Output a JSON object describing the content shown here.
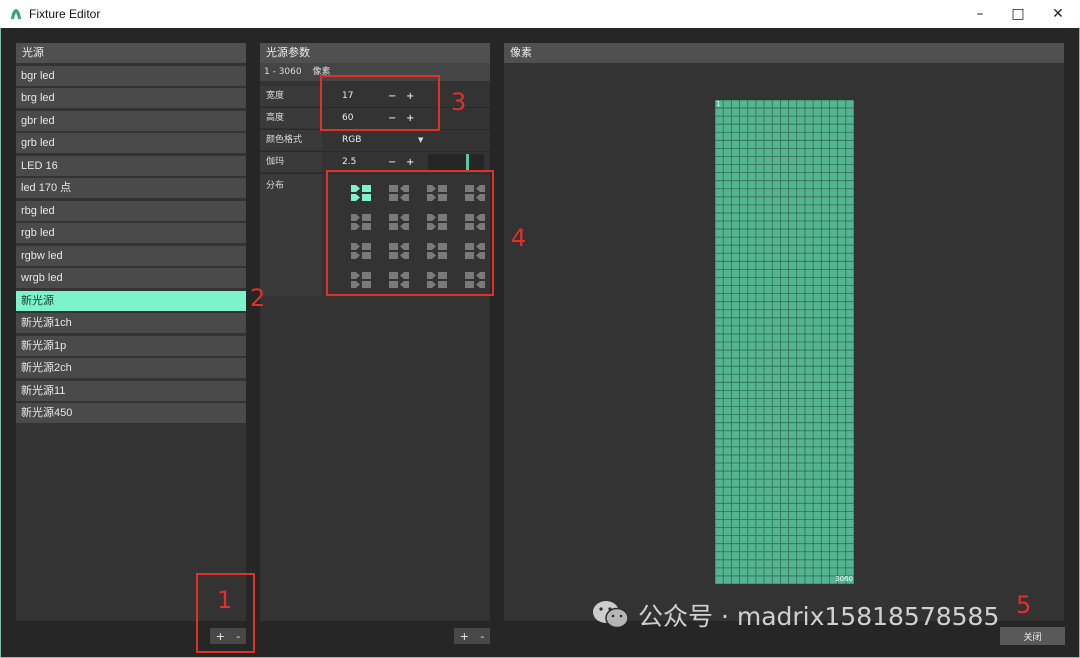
{
  "window": {
    "title": "Fixture Editor"
  },
  "fixtures_panel": {
    "title": "光源",
    "items": [
      "bgr led",
      "brg led",
      "gbr led",
      "grb led",
      "LED 16",
      "led 170 点",
      "rbg led",
      "rgb led",
      "rgbw led",
      "wrgb led",
      "新光源",
      "新光源1ch",
      "新光源1p",
      "新光源2ch",
      "新光源11",
      "新光源450"
    ],
    "selected_index": 10,
    "add_label": "+",
    "remove_label": "-"
  },
  "params_panel": {
    "title": "光源参数",
    "range_label": "1 - 3060",
    "pixel_label": "像素",
    "width": {
      "label": "宽度",
      "value": "17"
    },
    "height": {
      "label": "高度",
      "value": "60"
    },
    "color_format": {
      "label": "颜色格式",
      "value": "RGB"
    },
    "gamma": {
      "label": "伽玛",
      "value": "2.5"
    },
    "distribution": {
      "label": "分布"
    },
    "minus_label": "−",
    "plus_label": "+",
    "add_label": "+",
    "remove_label": "-"
  },
  "pixels_panel": {
    "title": "像素",
    "start_label": "1",
    "end_label": "3060",
    "columns": 17,
    "rows": 60,
    "fill_color": "#55b591",
    "grid_color": "#2f6b57"
  },
  "close_label": "关闭",
  "annotations": [
    "1",
    "2",
    "3",
    "4",
    "5"
  ],
  "watermark": "公众号 · madrix15818578585",
  "colors": {
    "accent": "#7cf3cb",
    "annotation": "#e0302a"
  }
}
